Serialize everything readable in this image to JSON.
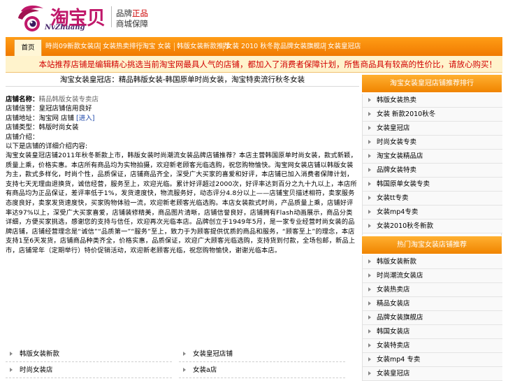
{
  "header": {
    "logo_cn": "淘宝贝",
    "logo_en": "NvZhuang",
    "slogan_line1_a": "品牌",
    "slogan_line1_b": "正品",
    "slogan_line2": "商城保障"
  },
  "nav": {
    "items": [
      {
        "label": "首页"
      },
      {
        "label": "時尚09新款女装店"
      },
      {
        "label": "女装热卖排行"
      },
      {
        "label": "淘宝 女装"
      },
      {
        "label": "韩版女装新款推荐"
      },
      {
        "label": "女装 2010 秋冬款"
      },
      {
        "label": "品牌女装旗舰店"
      },
      {
        "label": "女装皇冠店"
      }
    ]
  },
  "notice": "本站推荐店铺是编辑精心挑选当前淘宝网最具人气的店铺，都加入了消费者保障计划，所售商品具有较高的性价比，请放心购买！",
  "article": {
    "title": "淘宝女装皇冠店：精品韩版女装-韩国原单时尚女装，淘宝特卖流行秋冬女装",
    "info": {
      "shop_label": "店铺名称：",
      "shop_value": "精品韩版女装专卖店",
      "line2": "店铺信誉：皇冠店铺信用良好",
      "line3_a": "店铺地址：淘宝网 店铺 ",
      "line3_b": "[进入]",
      "line4": "店铺类型：韩版时尚女装",
      "line5": "店铺介绍：",
      "line6": "以下是店铺的详细介绍内容:"
    },
    "body": "淘宝女装皇冠店铺2011年秋冬新款上市，韩版女装时尚潮流女装品牌店铺推荐？本店主营韩国原单时尚女装，款式新颖，质量上乘，价格实惠。本店所有商品均为实物拍摄，欢迎新老顾客光临选购，祝您购物愉快。淘宝网女装店铺以韩版女装为主，款式多样化，时尚个性，品质保证，店铺商品齐全，深受广大买家的喜爱和好评，本店铺已加入消费者保障计划，支持七天无理由退换货，诚信经营，服务至上，欢迎光临。累计好评超过2000次，好评率达到百分之九十九以上，本店所有商品均为正品保证，差评率低于1%，发货速度快，物流服务好，动态评分4.8分以上——店铺宝贝描述相符，卖家服务态度良好，卖家发货速度快，买家购物体验一流，欢迎新老顾客光临选购。本店女装款式时尚，产品质量上乘，店铺好评率达97%以上，深受广大买家喜爱，店铺装修精美，商品图片清晰，店铺信誉良好，店铺拥有Flash动画展示，商品分类详细，方便买家挑选，感谢您的支持与信任，欢迎再次光临本店。品牌创立于1949年5月，是一家专业经营时尚女装的品牌店铺，店铺经营理念是“诚信”“品质第一”“服务”至上，致力于为顾客提供优质的商品和服务，“顾客至上”的理念，本店支持1至6天发货，店铺商品种类齐全，价格实惠，品质保证，欢迎广大顾客光临选购，支持货到付款，全场包邮，新品上市，店铺常年（定期举行）特价促销活动，欢迎新老顾客光临，祝您购物愉快，谢谢光临本店。"
  },
  "related": [
    {
      "label": "韩版女装新款"
    },
    {
      "label": "女装皇冠店铺"
    },
    {
      "label": "时尚女装店"
    },
    {
      "label": "女装a店"
    }
  ],
  "sidebar": {
    "section1_title": "淘宝女装皇冠店铺推荐排行",
    "section1_items": [
      {
        "label": "韩版女装热卖"
      },
      {
        "label": "女装 新款2010秋冬"
      },
      {
        "label": "女装皇冠店"
      },
      {
        "label": "时尚女装专卖"
      },
      {
        "label": "淘宝女装精品店"
      },
      {
        "label": "品牌女装特卖"
      },
      {
        "label": "韩国原单女装专卖"
      },
      {
        "label": "女装tt专卖"
      },
      {
        "label": "女装mp4专卖"
      },
      {
        "label": "女装2010秋冬新款"
      }
    ],
    "section2_title": "热门淘宝女装店铺推荐",
    "section2_items": [
      {
        "label": "韩版女装新款"
      },
      {
        "label": "时尚潮流女装店"
      },
      {
        "label": "女装热卖店"
      },
      {
        "label": "精品女装店"
      },
      {
        "label": "品牌女装旗舰店"
      },
      {
        "label": "韩国女装店"
      },
      {
        "label": "女装特卖店"
      },
      {
        "label": "女装mp4 专卖"
      },
      {
        "label": "女装皇冠店"
      }
    ]
  },
  "colors": {
    "nav_orange": "#f08400",
    "notice_red": "#d10000",
    "brand_magenta": "#c0186a"
  }
}
